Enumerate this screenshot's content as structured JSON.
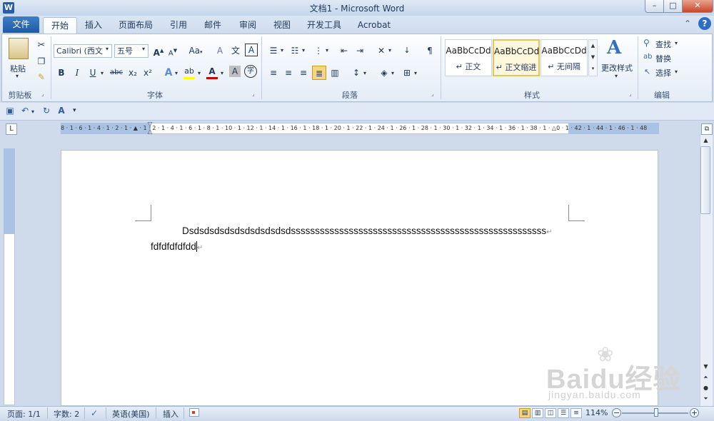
{
  "window": {
    "title": "文档1 - Microsoft Word",
    "app_icon": "W",
    "buttons": {
      "minimize": "–",
      "maximize": "□",
      "close": "✕"
    }
  },
  "tabs": [
    "文件",
    "开始",
    "插入",
    "页面布局",
    "引用",
    "邮件",
    "审阅",
    "视图",
    "开发工具",
    "Acrobat"
  ],
  "help": {
    "collapse": "⌃",
    "help": "?"
  },
  "ribbon": {
    "clipboard": {
      "paste": "粘贴",
      "label": "剪贴板"
    },
    "font": {
      "font_name": "Calibri (西文",
      "font_size": "五号",
      "grow": "A",
      "shrink": "A",
      "change_case": "Aa",
      "clear": "A",
      "phonetic": "文",
      "char_border": "A",
      "bold": "B",
      "italic": "I",
      "underline": "U",
      "strike": "abc",
      "sub": "x₂",
      "sup": "x²",
      "text_effect": "A",
      "highlight": "ab",
      "font_color": "A",
      "char_shade": "A",
      "enclose": "字",
      "label": "字体"
    },
    "paragraph": {
      "label": "段落"
    },
    "styles": {
      "items": [
        {
          "sample": "AaBbCcDd",
          "name": "↵ 正文"
        },
        {
          "sample": "AaBbCcDd",
          "name": "↵ 正文缩进"
        },
        {
          "sample": "AaBbCcDd",
          "name": "↵ 无间隔"
        }
      ],
      "change_styles": "更改样式",
      "label": "样式"
    },
    "editing": {
      "find": "查找",
      "replace": "替换",
      "select": "选择",
      "label": "编辑"
    }
  },
  "ruler": {
    "ticks": "8 · 1 · 6 · 1 · 4 · 1 · 2 · 1 · ▲ · 1 · 2 · 1 · 4 · 1 · 6 · 1 · 8 · 1 · 10 · 1 · 12 · 1 · 14 · 1 · 16 · 1 · 18 · 1 · 20 · 1 · 22 · 1 · 24 · 1 · 26 · 1 · 28 · 1 · 30 · 1 · 32 · 1 · 34 · 1 · 36 · 1 · 38 · 1 · △0 · 1 · 42 · 1 · 44 · 1 · 46 · 1 · 48"
  },
  "document": {
    "para1": "Dsdsdsdsdsdsdsdsdsdsdsssssssssssssssssssssssssssssssssssssssssssssssssssss",
    "para2": "fdfdfdfdfdd",
    "para_mark": "↵"
  },
  "status": {
    "page": "页面: 1/1",
    "words": "字数: 2",
    "language": "英语(美国)",
    "mode": "插入",
    "zoom": "114%"
  },
  "watermark": {
    "main": "Baidu经验",
    "sub": "jingyan.baidu.com"
  },
  "colors": {
    "accent": "#1f5aa8",
    "font_color_bar": "#d00000",
    "highlight_bar": "#ffff00"
  }
}
